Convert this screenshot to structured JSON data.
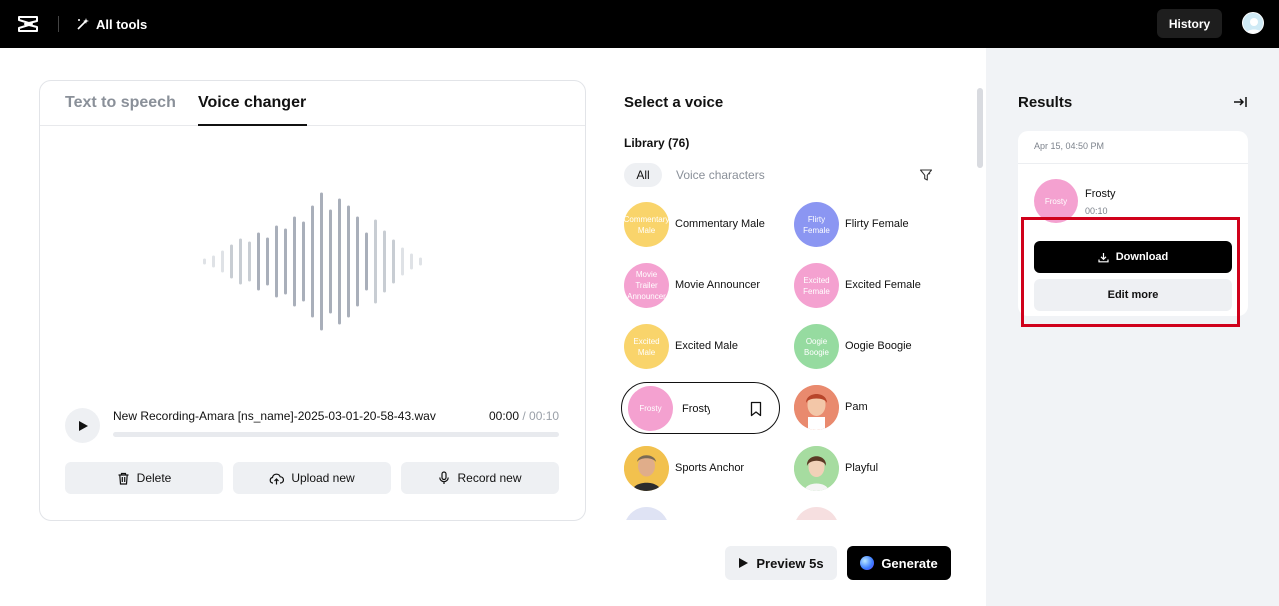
{
  "topbar": {
    "all_tools_label": "All tools",
    "history_label": "History"
  },
  "editor": {
    "tabs": [
      {
        "label": "Text to speech",
        "active": false
      },
      {
        "label": "Voice changer",
        "active": true
      }
    ],
    "recording": {
      "file_name": "New Recording-Amara [ns_name]-2025-03-01-20-58-43.wav",
      "current_time": "00:00",
      "separator": " / ",
      "total_time": "00:10",
      "progress": 0
    },
    "actions": {
      "delete_label": "Delete",
      "upload_label": "Upload new",
      "record_label": "Record new"
    }
  },
  "voices": {
    "title": "Select a voice",
    "library_label": "Library (76)",
    "filters": {
      "all_label": "All",
      "characters_label": "Voice characters"
    },
    "items": [
      {
        "name": "Commentary Male",
        "avatar_text": "Commentary Male",
        "color": "#f9d46b"
      },
      {
        "name": "Flirty Female",
        "avatar_text": "Flirty Female",
        "color": "#8b96f2"
      },
      {
        "name": "Movie Announcer",
        "avatar_text": "Movie Trailer Announcer",
        "color": "#f4a1d0"
      },
      {
        "name": "Excited Female",
        "avatar_text": "Excited Female",
        "color": "#f4a1d0"
      },
      {
        "name": "Excited Male",
        "avatar_text": "Excited Male",
        "color": "#f9d46b"
      },
      {
        "name": "Oogie Boogie",
        "avatar_text": "Oogie Boogie",
        "color": "#96dba0"
      },
      {
        "name": "Frosty",
        "avatar_text": "Frosty",
        "color": "#f4a1d0",
        "selected": true
      },
      {
        "name": "Pam",
        "avatar_text": "",
        "color": "#e98a6e"
      },
      {
        "name": "Sports Anchor",
        "avatar_text": "",
        "color": "#f2c14e"
      },
      {
        "name": "Playful",
        "avatar_text": "",
        "color": "#a6dca0"
      }
    ],
    "preview_label": "Preview 5s",
    "generate_label": "Generate"
  },
  "results": {
    "title": "Results",
    "items": [
      {
        "date": "Apr 15, 04:50 PM",
        "avatar_text": "Frosty",
        "name": "Frosty",
        "duration": "00:10",
        "download_label": "Download",
        "edit_label": "Edit more"
      }
    ]
  },
  "colors": {
    "highlight": "#d0011b",
    "topbar": "#000000",
    "panel_bg": "#f1f3f6"
  },
  "icons": {
    "logo": "capcut-logo-icon",
    "all_tools": "magic-wand-icon",
    "play": "play-icon",
    "delete": "trash-icon",
    "upload": "cloud-upload-icon",
    "record": "microphone-icon",
    "filter": "filter-icon",
    "bookmark": "bookmark-icon",
    "collapse": "collapse-panel-icon",
    "download": "download-icon"
  }
}
